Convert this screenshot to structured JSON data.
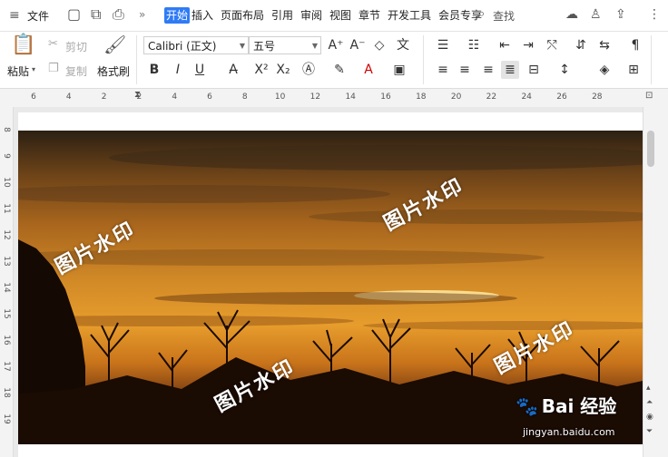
{
  "menubar": {
    "menu_label": "文件",
    "more_label": "»",
    "tabs": [
      "开始",
      "插入",
      "页面布局",
      "引用",
      "审阅",
      "视图",
      "章节",
      "开发工具",
      "会员专享"
    ],
    "active_tab": "开始",
    "search_label": "查找"
  },
  "ribbon": {
    "paste": "粘贴",
    "cut": "剪切",
    "copy": "复制",
    "format_painter": "格式刷",
    "font_name": "Calibri (正文)",
    "font_size": "五号"
  },
  "ruler": {
    "h_ticks": [
      "6",
      "4",
      "2",
      "2",
      "4",
      "6",
      "8",
      "10",
      "12",
      "14",
      "16",
      "18",
      "20",
      "22",
      "24",
      "26",
      "28"
    ],
    "v_ticks": [
      "8",
      "9",
      "10",
      "11",
      "12",
      "13",
      "14",
      "15",
      "16",
      "17",
      "18",
      "19"
    ]
  },
  "document": {
    "watermarks": [
      "图片水印",
      "图片水印",
      "图片水印",
      "图片水印"
    ]
  },
  "brand": {
    "logo_text": "Bai 经验",
    "url": "jingyan.baidu.com"
  },
  "colors": {
    "accent": "#2f7bf5"
  }
}
